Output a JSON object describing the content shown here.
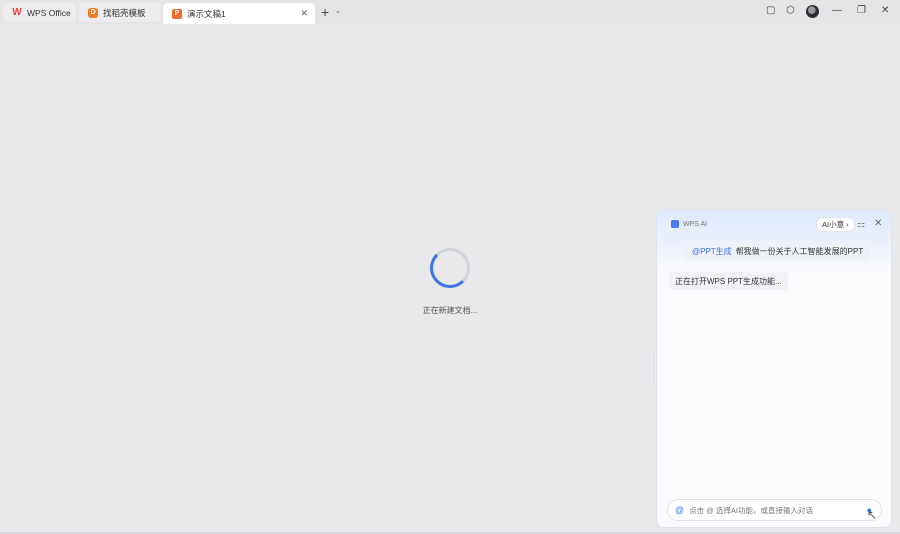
{
  "tabs": [
    {
      "label": "WPS Office",
      "icon": "wps-logo-icon",
      "logo_text": "W"
    },
    {
      "label": "找稻壳模板",
      "icon": "docer-icon",
      "logo_text": "D"
    },
    {
      "label": "演示文稿1",
      "icon": "presentation-icon",
      "logo_text": "P",
      "active": true
    }
  ],
  "tab_close_glyph": "✕",
  "new_tab_glyph": "+",
  "loading": {
    "text": "正在新建文档..."
  },
  "ai_panel": {
    "title": "WPS AI",
    "chip_label": "AI小意 ›",
    "close_glyph": "✕",
    "grid_glyph": "⚏",
    "user_message": {
      "tag": "@PPT生成",
      "text": "帮我做一份关于人工智能发展的PPT"
    },
    "bot_message": "正在打开WPS PPT生成功能...",
    "input": {
      "at_glyph": "@",
      "placeholder": "点击 @ 选择AI功能，或直接输入对话"
    }
  },
  "colors": {
    "accent": "#3b73e8",
    "ppt": "#ee6a2b",
    "wps": "#e8403a"
  }
}
